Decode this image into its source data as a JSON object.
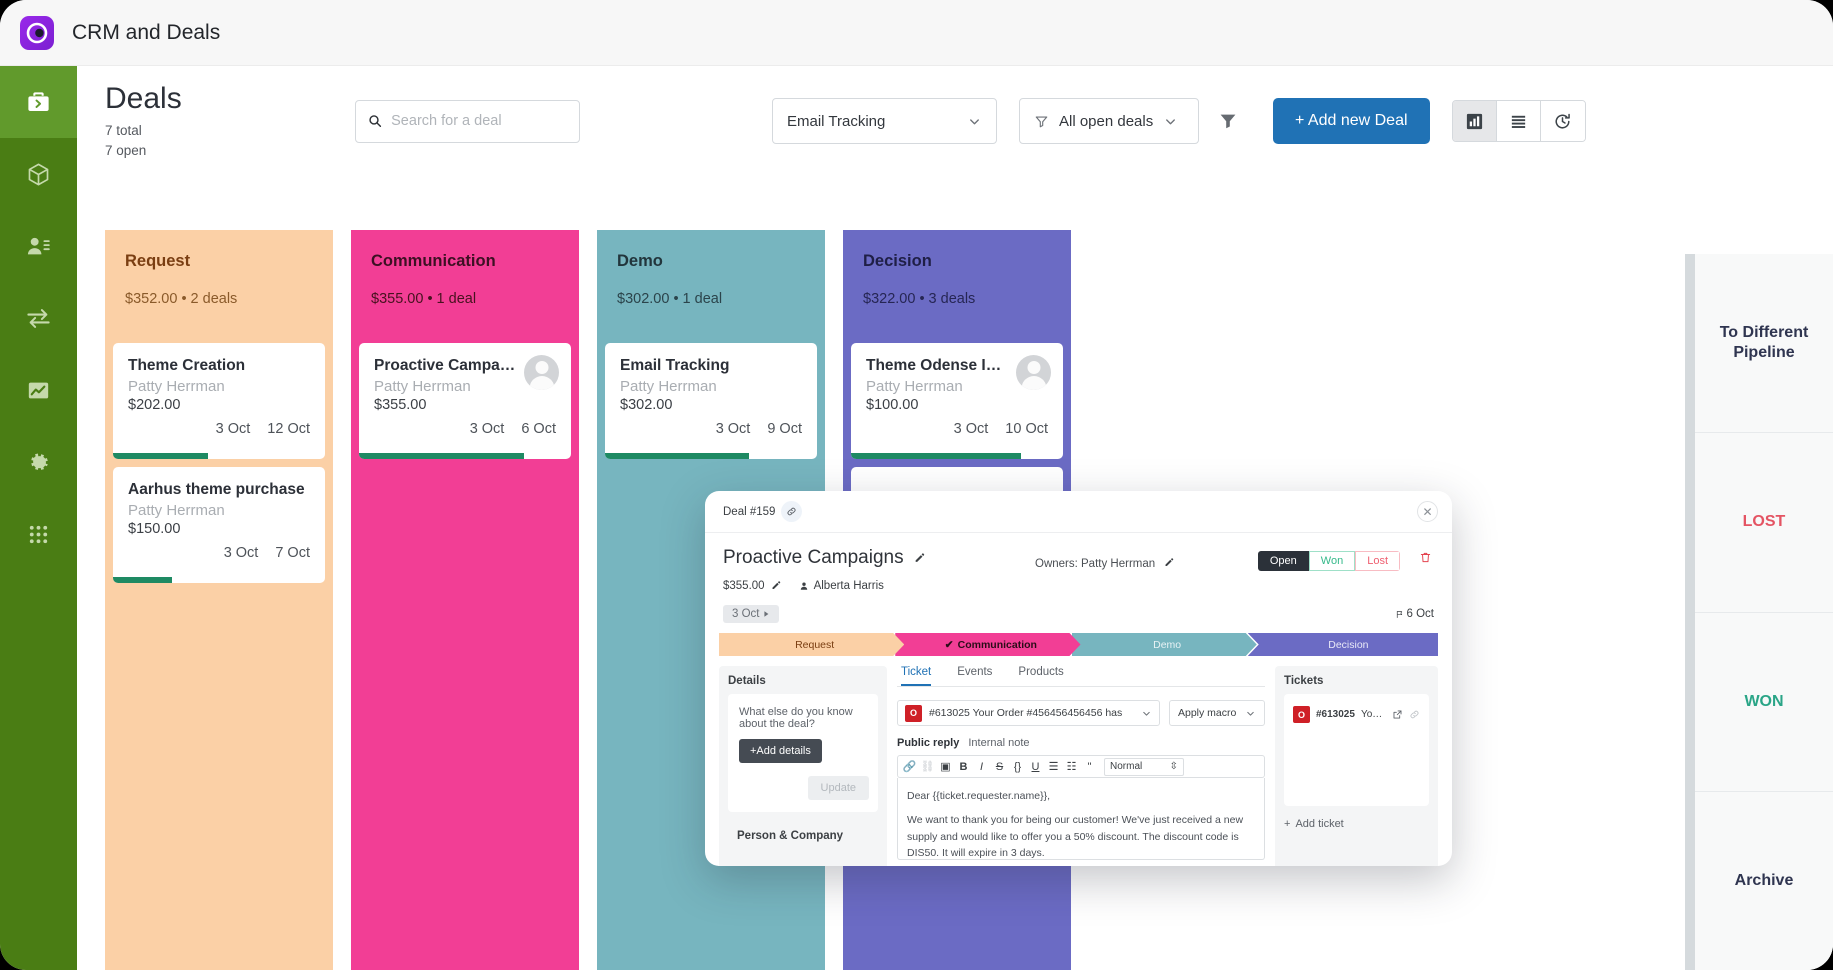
{
  "window": {
    "app_title": "CRM and Deals",
    "logo_icon": "crm-circle-logo"
  },
  "sidebar": {
    "items": [
      {
        "icon": "briefcase-icon",
        "name": "deals",
        "active": true
      },
      {
        "icon": "cube-icon",
        "name": "products",
        "active": false
      },
      {
        "icon": "contacts-icon",
        "name": "contacts",
        "active": false
      },
      {
        "icon": "transfer-arrows-icon",
        "name": "transfers",
        "active": false
      },
      {
        "icon": "chart-icon",
        "name": "reports",
        "active": false
      },
      {
        "icon": "gear-icon",
        "name": "settings",
        "active": false
      },
      {
        "icon": "grid-apps-icon",
        "name": "apps",
        "active": false
      }
    ]
  },
  "header": {
    "title": "Deals",
    "total_line": "7 total",
    "open_line": "7 open",
    "search_placeholder": "Search for a deal",
    "search_value": "",
    "pipeline_select": "Email Tracking",
    "filter_select": "All open deals",
    "add_button": "+ Add new Deal",
    "views": [
      {
        "icon": "kanban-chart-icon",
        "name": "board-view",
        "active": true
      },
      {
        "icon": "list-icon",
        "name": "list-view",
        "active": false
      },
      {
        "icon": "history-icon",
        "name": "history-view",
        "active": false
      }
    ]
  },
  "board": {
    "columns": [
      {
        "name": "Request",
        "meta": "$352.00 • 2 deals",
        "bg": "#fbd0a6",
        "title_color": "#7a3e12",
        "meta_color": "#8a5a2a",
        "cards": [
          {
            "title": "Theme Creation",
            "owner": "Patty Herrman",
            "amount": "$202.00",
            "start": "3 Oct",
            "due": "12 Oct",
            "progress": 45,
            "avatar": false
          },
          {
            "title": "Aarhus theme purchase",
            "owner": "Patty Herrman",
            "amount": "$150.00",
            "start": "3 Oct",
            "due": "7 Oct",
            "progress": 28,
            "avatar": false
          }
        ]
      },
      {
        "name": "Communication",
        "meta": "$355.00 • 1 deal",
        "bg": "#f23e95",
        "title_color": "#3d1023",
        "meta_color": "#47121f",
        "cards": [
          {
            "title": "Proactive Campaigns",
            "owner": "Patty Herrman",
            "amount": "$355.00",
            "start": "3 Oct",
            "due": "6 Oct",
            "progress": 78,
            "avatar": true
          }
        ]
      },
      {
        "name": "Demo",
        "meta": "$302.00 • 1 deal",
        "bg": "#77b5bf",
        "title_color": "#22353c",
        "meta_color": "#2b444b",
        "cards": [
          {
            "title": "Email Tracking",
            "owner": "Patty Herrman",
            "amount": "$302.00",
            "start": "3 Oct",
            "due": "9 Oct",
            "progress": 68,
            "avatar": false
          }
        ]
      },
      {
        "name": "Decision",
        "meta": "$322.00 • 3 deals",
        "bg": "#6b6bc4",
        "title_color": "#1f1f46",
        "meta_color": "#262654",
        "cards": [
          {
            "title": "Theme Odense Imp…",
            "owner": "Patty Herrman",
            "amount": "$100.00",
            "start": "3 Oct",
            "due": "10 Oct",
            "progress": 80,
            "avatar": true
          },
          {
            "title": "",
            "owner": "",
            "amount": "",
            "start": "",
            "due": "",
            "progress": 0,
            "avatar": false
          }
        ]
      }
    ]
  },
  "rail": {
    "zones": [
      {
        "label": "To Different Pipeline",
        "color": "#2f3550"
      },
      {
        "label": "LOST",
        "color": "#e45463"
      },
      {
        "label": "WON",
        "color": "#2aa587"
      },
      {
        "label": "Archive",
        "color": "#2f3550"
      }
    ]
  },
  "modal": {
    "deal_id": "Deal #159",
    "link_icon": "link-icon",
    "close_icon": "close-icon",
    "deal_name": "Proactive Campaigns",
    "deal_amount": "$355.00",
    "contact": "Alberta Harris",
    "owners": "Owners: Patty Herrman",
    "status": [
      {
        "label": "Open",
        "state": "open",
        "active": true
      },
      {
        "label": "Won",
        "state": "won",
        "active": false
      },
      {
        "label": "Lost",
        "state": "lost",
        "active": false
      }
    ],
    "delete_icon": "trash-icon",
    "start_date": "3 Oct",
    "due_date": "6 Oct",
    "stages": [
      {
        "label": "Request",
        "bg": "#fbd0a6",
        "color": "#7a3e12",
        "active": false,
        "checked": false
      },
      {
        "label": "Communication",
        "bg": "#f23e95",
        "color": "#2b0c18",
        "active": true,
        "checked": true
      },
      {
        "label": "Demo",
        "bg": "#77b5bf",
        "color": "#e7f2f4",
        "active": false,
        "checked": false
      },
      {
        "label": "Decision",
        "bg": "#6b6bc4",
        "color": "#e9e9f7",
        "active": false,
        "checked": false
      }
    ],
    "details": {
      "panel_title": "Details",
      "question": "What else do you know about the deal?",
      "add_button": "+Add details",
      "update_button": "Update",
      "person_company_title": "Person & Company"
    },
    "tabs": [
      {
        "label": "Ticket",
        "active": true
      },
      {
        "label": "Events",
        "active": false
      },
      {
        "label": "Products",
        "active": false
      }
    ],
    "ticket_select": "#613025 Your Order #456456456456 has",
    "macro_select": "Apply macro",
    "reply_tabs": [
      {
        "label": "Public reply",
        "active": true
      },
      {
        "label": "Internal note",
        "active": false
      }
    ],
    "rte_buttons": [
      {
        "icon": "link-icon",
        "glyph": "🔗",
        "dim": false
      },
      {
        "icon": "unlink-icon",
        "glyph": "⛓",
        "dim": true
      },
      {
        "icon": "image-icon",
        "glyph": "▣",
        "dim": false
      },
      {
        "icon": "bold-icon",
        "glyph": "B",
        "dim": false
      },
      {
        "icon": "italic-icon",
        "glyph": "I",
        "dim": false
      },
      {
        "icon": "strikethrough-icon",
        "glyph": "S",
        "dim": false
      },
      {
        "icon": "code-icon",
        "glyph": "{}",
        "dim": false
      },
      {
        "icon": "underline-icon",
        "glyph": "U",
        "dim": false
      },
      {
        "icon": "bullet-list-icon",
        "glyph": "☰",
        "dim": false
      },
      {
        "icon": "numbered-list-icon",
        "glyph": "☷",
        "dim": false
      },
      {
        "icon": "quote-icon",
        "glyph": "\"",
        "dim": false
      }
    ],
    "rte_style": "Normal",
    "message_greeting": "Dear {{ticket.requester.name}},",
    "message_body": "We want to thank you for being our customer! We've just received a new supply and would like to offer you a 50% discount. The discount code is DIS50. It will expire in 3 days.",
    "tickets_panel": {
      "title": "Tickets",
      "badge": "O",
      "ticket_id": "#613025",
      "ticket_subject": "Your Order …",
      "open_icon": "external-link-icon",
      "unlink_icon": "unlink-icon",
      "add_ticket": "Add ticket"
    }
  },
  "colors": {
    "accent_blue": "#2072b5",
    "nav_green": "#4a7d14",
    "nav_green_active": "#619a2c",
    "progress_green": "#1e8a63"
  }
}
